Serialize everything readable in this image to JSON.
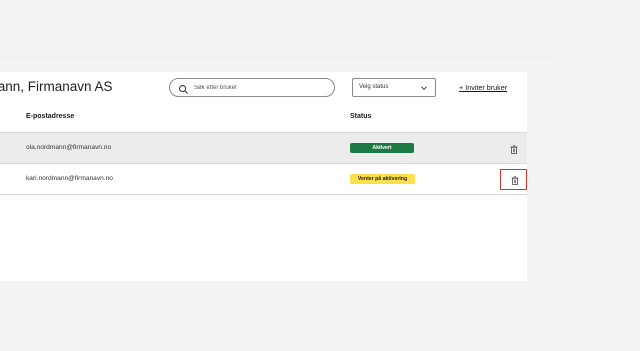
{
  "header": {
    "title": "rmann, Firmanavn AS",
    "search": {
      "placeholder": "Søk etter bruker",
      "value": ""
    },
    "status_select": {
      "selected": "Velg status"
    },
    "invite_label": "+ Inviter bruker"
  },
  "table": {
    "columns": [
      "E-postadresse",
      "Status"
    ],
    "rows": [
      {
        "email": "ola.nordmann@firmanavn.no",
        "status": "Aktivert",
        "status_color": "#1d7a46"
      },
      {
        "email": "kari.nordmann@firmanavn.no",
        "status": "Venter på aktivering",
        "status_color": "#fbe04b"
      }
    ]
  },
  "icons": {
    "search": "search-icon",
    "chevron": "chevron-down-icon",
    "delete": "trash-icon"
  },
  "colors": {
    "focus_outline": "#d9342b"
  }
}
